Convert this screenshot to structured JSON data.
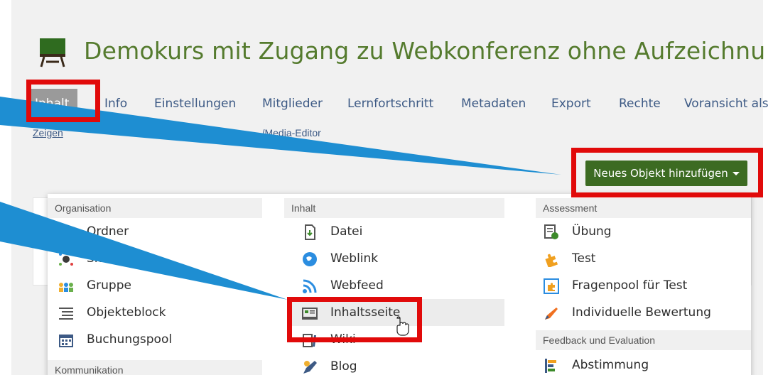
{
  "course": {
    "title": "Demokurs mit Zugang zu Webkonferenz ohne Aufzeichnu"
  },
  "tabs": [
    {
      "label": "Inhalt"
    },
    {
      "label": "Info"
    },
    {
      "label": "Einstellungen"
    },
    {
      "label": "Mitglieder"
    },
    {
      "label": "Lernfortschritt"
    },
    {
      "label": "Metadaten"
    },
    {
      "label": "Export"
    },
    {
      "label": "Rechte"
    },
    {
      "label": "Voransicht als"
    }
  ],
  "subtabs": {
    "show": "Zeigen",
    "media_editor": "/Media-Editor"
  },
  "toolbar": {
    "add_object_label": "Neues Objekt hinzufügen"
  },
  "menu": {
    "organisation": {
      "heading": "Organisation",
      "items": [
        "Ordner",
        "Sitzung",
        "Gruppe",
        "Objekteblock",
        "Buchungspool"
      ],
      "heading2": "Kommunikation"
    },
    "inhalt": {
      "heading": "Inhalt",
      "items": [
        "Datei",
        "Weblink",
        "Webfeed",
        "Inhaltsseite",
        "Wiki",
        "Blog"
      ]
    },
    "assessment": {
      "heading": "Assessment",
      "items": [
        "Übung",
        "Test",
        "Fragenpool für Test",
        "Individuelle Bewertung"
      ],
      "heading2": "Feedback und Evaluation",
      "items2": [
        "Abstimmung"
      ]
    }
  },
  "colors": {
    "title_green": "#557b2e",
    "button_green": "#3c6b22",
    "highlight_red": "#e10a0a",
    "arrow_blue": "#1e8ed2"
  }
}
